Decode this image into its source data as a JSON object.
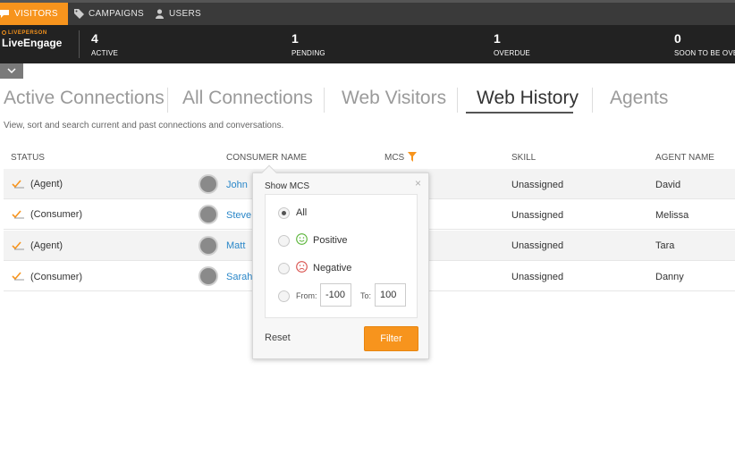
{
  "nav": {
    "items": [
      {
        "label": "VISITORS",
        "icon": "chat-bubble-icon"
      },
      {
        "label": "CAMPAIGNS",
        "icon": "tag-icon"
      },
      {
        "label": "USERS",
        "icon": "user-icon"
      }
    ]
  },
  "brand": {
    "small": "LIVEPERSON",
    "name": "LiveEngage"
  },
  "stats": [
    {
      "value": "4",
      "label": "ACTIVE"
    },
    {
      "value": "1",
      "label": "PENDING"
    },
    {
      "value": "1",
      "label": "OVERDUE"
    },
    {
      "value": "0",
      "label": "SOON TO BE OVERDUE"
    }
  ],
  "tabs": [
    {
      "label": "Active Connections"
    },
    {
      "label": "All Connections"
    },
    {
      "label": "Web Visitors"
    },
    {
      "label": "Web History"
    },
    {
      "label": "Agents"
    }
  ],
  "subtitle": "View, sort and search current and past connections and conversations.",
  "table": {
    "headers": {
      "status": "STATUS",
      "consumer": "CONSUMER NAME",
      "mcs": "MCS",
      "skill": "SKILL",
      "agent": "AGENT NAME"
    },
    "rows": [
      {
        "status": "(Agent)",
        "consumer": "John",
        "skill": "Unassigned",
        "agent": "David"
      },
      {
        "status": "(Consumer)",
        "consumer": "Steve",
        "skill": "Unassigned",
        "agent": "Melissa"
      },
      {
        "status": "(Agent)",
        "consumer": "Matt",
        "skill": "Unassigned",
        "agent": "Tara"
      },
      {
        "status": "(Consumer)",
        "consumer": "Sarah",
        "skill": "Unassigned",
        "agent": "Danny"
      }
    ]
  },
  "popup": {
    "title": "Show MCS",
    "close": "×",
    "options": {
      "all": "All",
      "positive": "Positive",
      "negative": "Negative"
    },
    "selected": "All",
    "range": {
      "from_label": "From:",
      "from_value": "-100",
      "to_label": "To:",
      "to_value": "100"
    },
    "reset": "Reset",
    "filter": "Filter"
  },
  "colors": {
    "accent": "#f7941d",
    "link": "#2a87c9",
    "positive": "#5bb53a",
    "negative": "#d9534f"
  }
}
